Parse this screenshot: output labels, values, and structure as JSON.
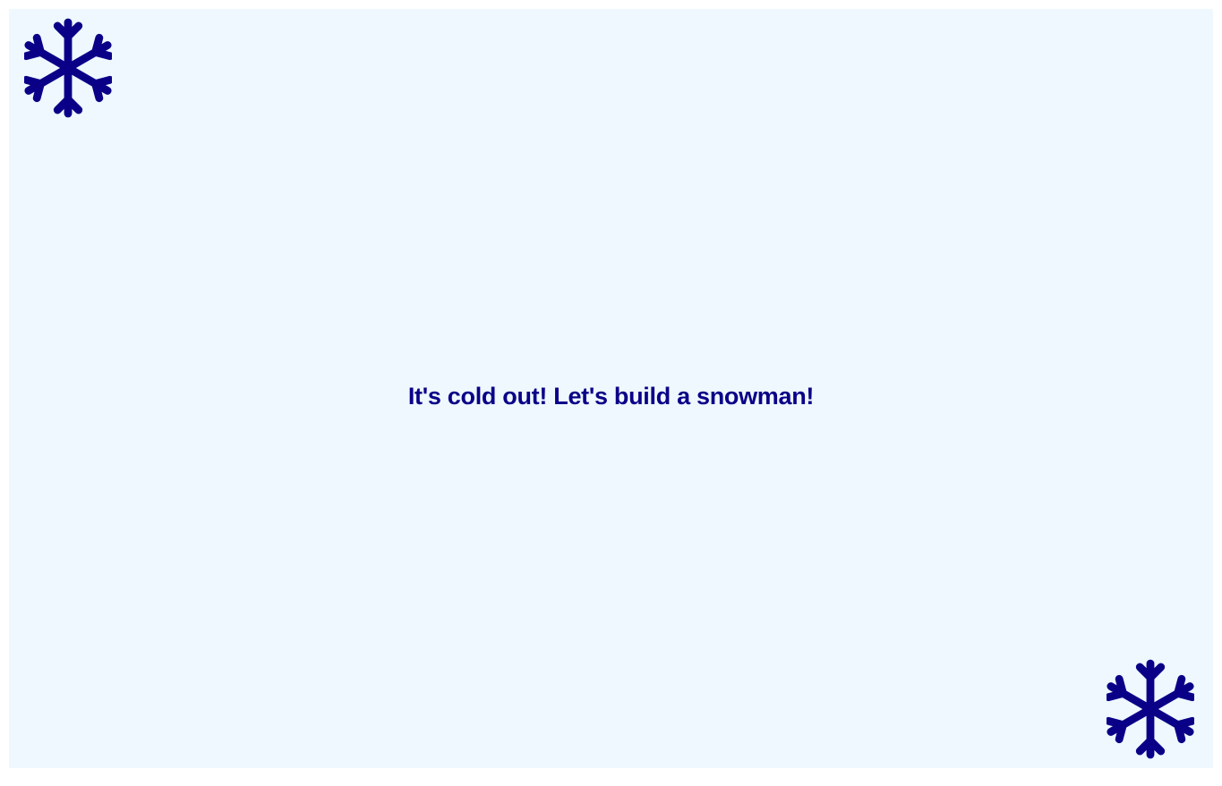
{
  "page": {
    "background": "#eef8fe",
    "outer_background": "#ffffff"
  },
  "message": {
    "text": "It's cold out! Let's build a snowman!",
    "color": "#0a0088"
  },
  "decorations": {
    "top_left_icon": "snowflake-icon",
    "bottom_right_icon": "snowflake-icon",
    "icon_color": "#0a0088"
  }
}
